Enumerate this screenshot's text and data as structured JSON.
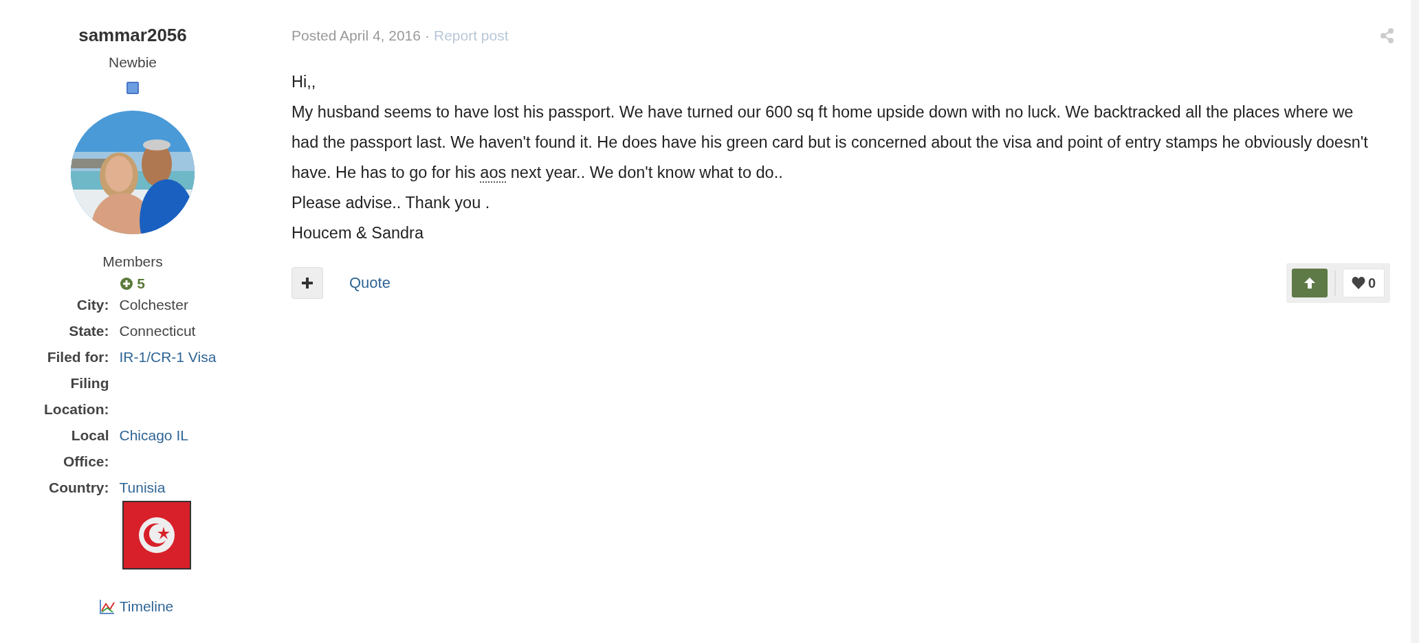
{
  "author": {
    "name": "sammar2056",
    "rank": "Newbie",
    "group": "Members",
    "reputation": "5",
    "fields": [
      {
        "label": "City:",
        "value": "Colchester",
        "kind": "text"
      },
      {
        "label": "State:",
        "value": "Connecticut",
        "kind": "text"
      },
      {
        "label": "Filed for:",
        "value": "IR-1/CR-1 Visa",
        "kind": "link"
      },
      {
        "label": "Filing Location:",
        "kind": "text"
      },
      {
        "label": "Local Office:",
        "value": "Chicago IL",
        "kind": "link"
      },
      {
        "label": "Country:",
        "value": "Tunisia",
        "kind": "link"
      }
    ],
    "timeline": "Timeline"
  },
  "post": {
    "posted": "Posted April 4, 2016",
    "separator": "·",
    "report": "Report post",
    "body": [
      {
        "kind": "line",
        "text": "Hi,,"
      },
      {
        "kind": "abbr_line",
        "before": "My husband seems to have lost his passport. We have turned our 600 sq ft home upside down with no luck. We backtracked all the places where we had the passport last. We haven't found it. He does have his green card but is concerned about the visa and point of entry stamps he obviously doesn't have. He has to go for his",
        "abbr": "aos",
        "after": "next year.. We don't know what to do.."
      },
      {
        "kind": "line",
        "text": "Please advise.. Thank you ."
      },
      {
        "kind": "line",
        "text": "Houcem & Sandra"
      }
    ],
    "quote": "Quote",
    "reaction_count": "0"
  }
}
